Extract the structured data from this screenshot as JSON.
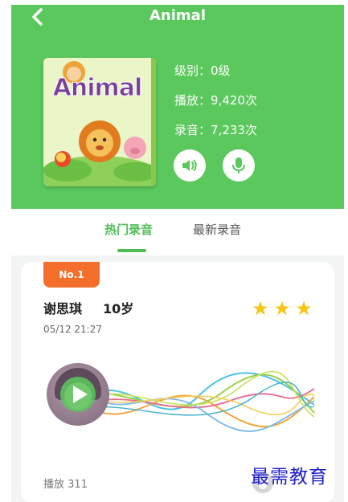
{
  "header": {
    "back_icon": "chevron-left-icon",
    "title": "Animal",
    "background_color": "#5ac85c"
  },
  "book": {
    "cover_title": "Animal",
    "level_label": "级别：",
    "level_value": "0级",
    "plays_label": "播放：",
    "plays_value": "9,420次",
    "recordings_label": "录音：",
    "recordings_value": "7,233次",
    "listen_icon": "speaker-icon",
    "record_icon": "microphone-icon"
  },
  "tabs": {
    "items": [
      {
        "label": "热门录音",
        "active": true
      },
      {
        "label": "最新录音",
        "active": false
      }
    ],
    "accent_color": "#4fbf55"
  },
  "recording": {
    "rank": "No.1",
    "rank_color": "#f36f2b",
    "user_name": "谢思琪",
    "user_age": "10岁",
    "timestamp": "05/12 21:27",
    "stars": 3,
    "star_color": "#f5c518",
    "play_label": "播放",
    "play_count": "311",
    "play_icon": "play-icon",
    "like_icon": "like-icon"
  },
  "watermark": {
    "text": "最需教育",
    "color": "#1d1dcc"
  }
}
